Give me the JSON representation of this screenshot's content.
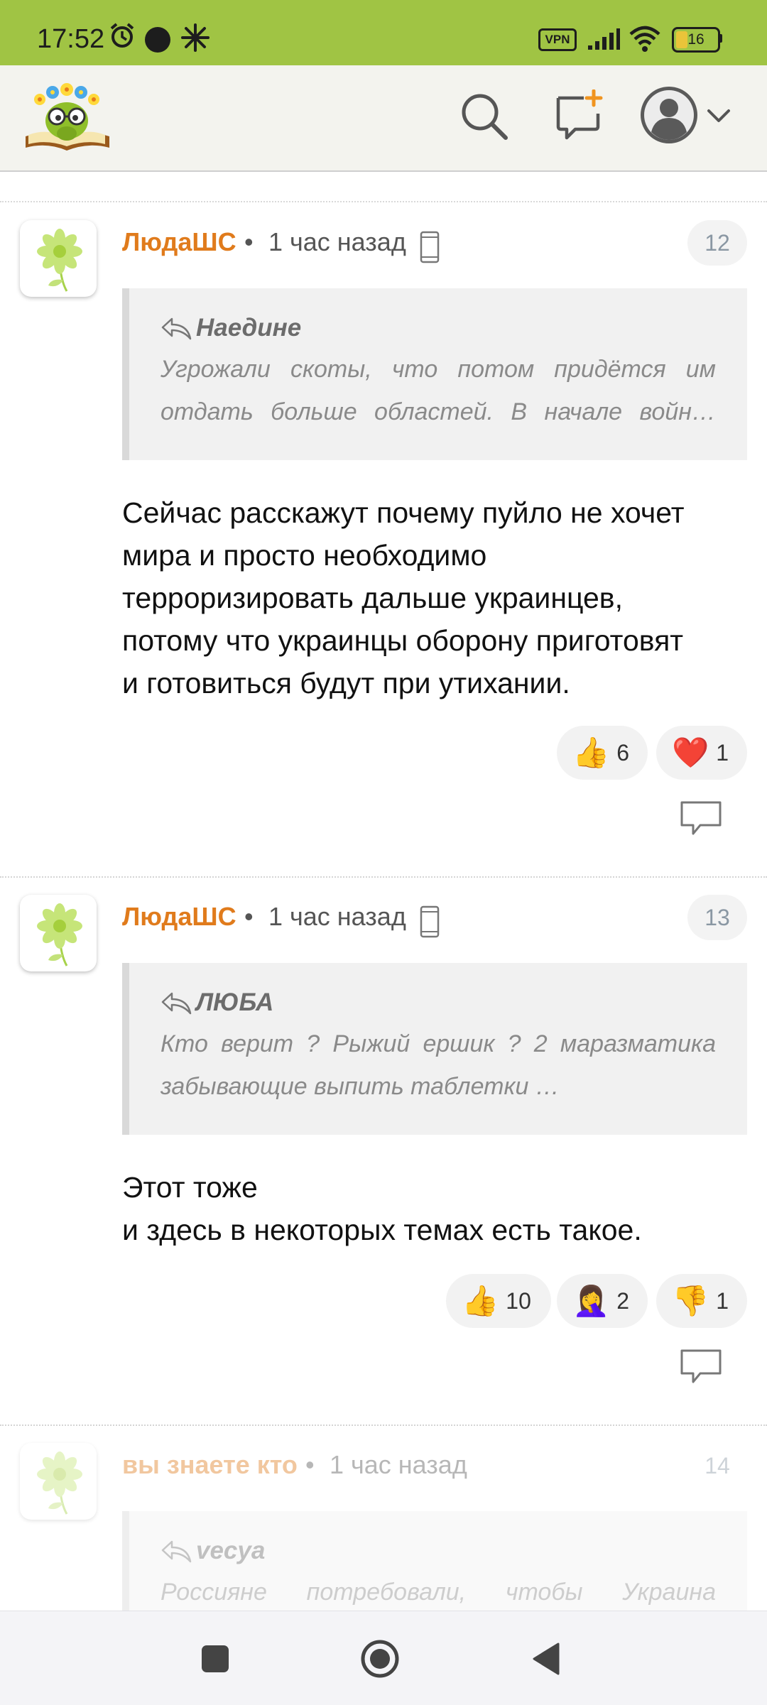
{
  "status_bar": {
    "time": "17:52",
    "vpn": "VPN",
    "battery": "16"
  },
  "header": {
    "logo": "site-logo",
    "icons": [
      "search-icon",
      "new-post-icon",
      "user-avatar-icon",
      "chevron-down-icon"
    ]
  },
  "comments": [
    {
      "author": "ЛюдаШС",
      "separator": "•",
      "time": "1 час назад",
      "number": "12",
      "quote_author": "Наедине",
      "quote_line1": "Угрожали скоты, что потом придётся им",
      "quote_line2": "отдать больше областей. В начале войн…",
      "body": [
        "Сейчас расскажут почему пуйло не хочет",
        "мира и просто необходимо",
        "терроризировать дальше украинцев,",
        "потому что украинцы оборону приготовят",
        "и готовиться будут при утихании."
      ],
      "reactions": [
        {
          "emoji": "👍",
          "count": "6"
        },
        {
          "emoji": "❤️",
          "count": "1"
        }
      ]
    },
    {
      "author": "ЛюдаШС",
      "separator": "•",
      "time": "1 час назад",
      "number": "13",
      "quote_author": "ЛЮБА",
      "quote_line1": "Кто верит ? Рыжий ершик ? 2 маразматика",
      "quote_line2": "забывающие выпить таблетки …",
      "body": [
        "Этот тоже",
        "и здесь в некоторых темах есть такое."
      ],
      "reactions": [
        {
          "emoji": "👍",
          "count": "10"
        },
        {
          "emoji": "🤦‍♀️",
          "count": "2"
        },
        {
          "emoji": "👎",
          "count": "1"
        }
      ]
    },
    {
      "author": "вы знаете кто",
      "separator": "•",
      "time": "1 час назад",
      "number": "14",
      "quote_author": "vecya",
      "quote_line1": "Россияне потребовали, чтобы Украина"
    }
  ],
  "colors": {
    "status_bar": "#a0c444",
    "author": "#e07b1c",
    "header": "#f3f3ee"
  }
}
